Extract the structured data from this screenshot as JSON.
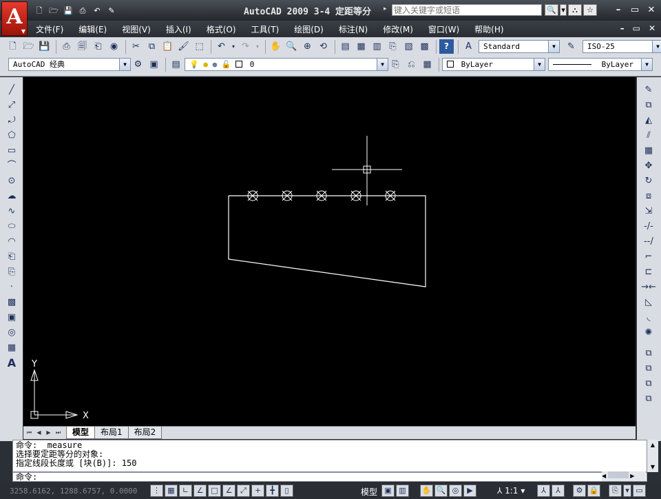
{
  "app": {
    "logo": "A",
    "window_title": "AutoCAD 2009  3-4 定距等分",
    "search_placeholder": "键入关键字或短语"
  },
  "quick_access": [
    "new-icon",
    "open-icon",
    "save-icon",
    "print-icon",
    "undo-icon",
    "properties-icon"
  ],
  "window_controls": {
    "minimize": "–",
    "restore": "▭",
    "close": "✕"
  },
  "menu": {
    "items": [
      "文件(F)",
      "编辑(E)",
      "视图(V)",
      "插入(I)",
      "格式(O)",
      "工具(T)",
      "绘图(D)",
      "标注(N)",
      "修改(M)",
      "窗口(W)",
      "帮助(H)"
    ],
    "mdi": {
      "minimize": "–",
      "restore": "▭",
      "close": "✕"
    }
  },
  "toolbar": {
    "text_style": "Standard",
    "dim_style": "ISO-25",
    "workspace": "AutoCAD 经典",
    "layer": "0",
    "color": "ByLayer",
    "linetype": "ByLayer"
  },
  "tabs": {
    "model": "模型",
    "layout1": "布局1",
    "layout2": "布局2"
  },
  "command": {
    "lines": [
      "命令: _measure",
      "选择要定距等分的对象:",
      "指定线段长度或 [块(B)]: 150"
    ],
    "prompt": "命令:"
  },
  "status": {
    "coords": "3258.6162, 1288.6757, 0.0000",
    "model": "模型",
    "scale": "1:1"
  },
  "ucs": {
    "x": "X",
    "y": "Y"
  },
  "colors": {
    "canvas": "#000000",
    "geometry": "#ffffff",
    "chrome": "#2a2d33",
    "toolbar": "#d9dde3"
  }
}
